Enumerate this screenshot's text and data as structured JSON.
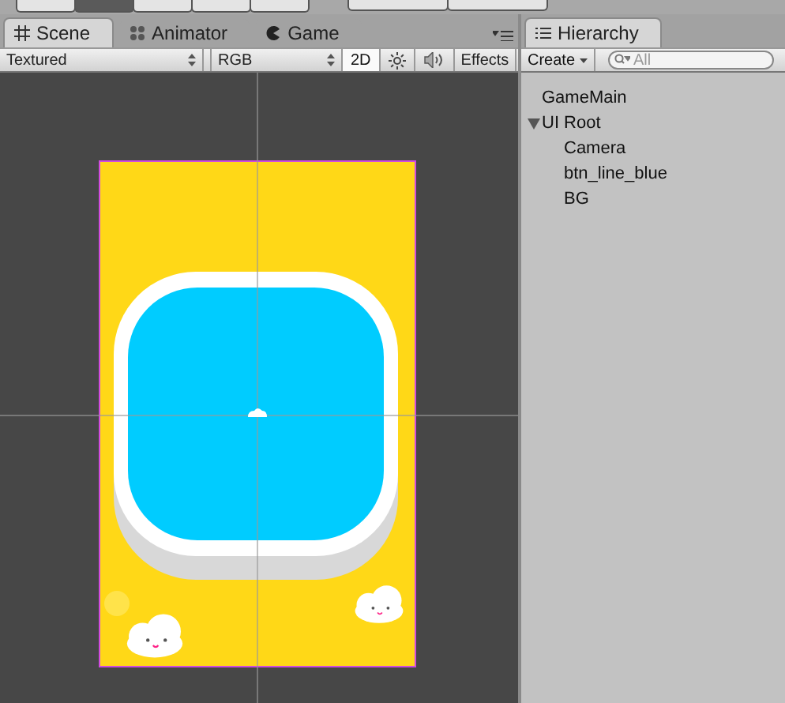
{
  "tools": [
    {
      "selected": false
    },
    {
      "selected": true
    },
    {
      "selected": false
    },
    {
      "selected": false
    },
    {
      "selected": false
    }
  ],
  "pivot_buttons": [
    {
      "kind": "plain"
    },
    {
      "kind": "plain"
    }
  ],
  "scene_tabs": [
    {
      "label": "Scene",
      "selected": true
    },
    {
      "label": "Animator",
      "selected": false
    },
    {
      "label": "Game",
      "selected": false
    }
  ],
  "scene_toolbar": {
    "items": [
      {
        "kind": "dropdown",
        "label": "Textured"
      },
      {
        "kind": "dropdown",
        "label": "RGB"
      },
      {
        "kind": "toggle",
        "label": "2D",
        "on": true
      },
      {
        "kind": "sun"
      },
      {
        "kind": "sound"
      },
      {
        "kind": "menu",
        "label": "Effects"
      }
    ]
  },
  "hierarchy": {
    "tab": {
      "label": "Hierarchy",
      "selected": true
    },
    "create": "Create",
    "search": {
      "placeholder": "All"
    },
    "items": [
      {
        "label": "GameMain"
      },
      {
        "label": "UI Root",
        "expanded": true,
        "children": [
          {
            "label": "Camera"
          },
          {
            "label": "btn_line_blue"
          },
          {
            "label": "BG"
          }
        ]
      }
    ]
  }
}
